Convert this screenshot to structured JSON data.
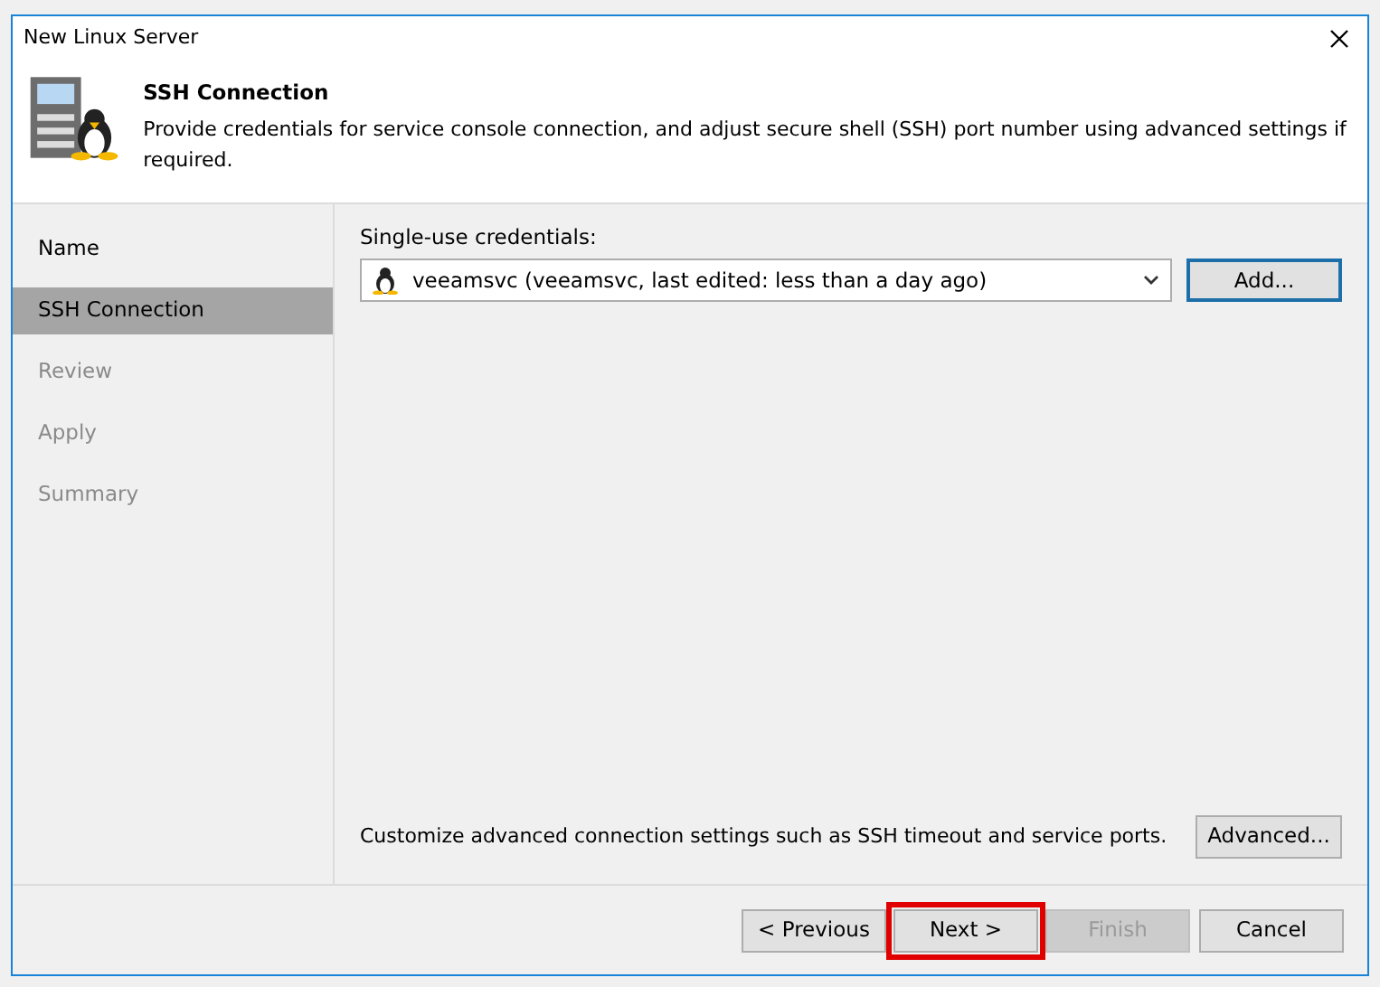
{
  "window": {
    "title": "New Linux Server"
  },
  "header": {
    "title": "SSH Connection",
    "description": "Provide credentials for service console connection, and adjust secure shell (SSH) port number using advanced settings if required."
  },
  "steps": [
    {
      "label": "Name",
      "selected": false,
      "disabled": false
    },
    {
      "label": "SSH Connection",
      "selected": true,
      "disabled": false
    },
    {
      "label": "Review",
      "selected": false,
      "disabled": true
    },
    {
      "label": "Apply",
      "selected": false,
      "disabled": true
    },
    {
      "label": "Summary",
      "selected": false,
      "disabled": true
    }
  ],
  "credentials": {
    "label": "Single-use credentials:",
    "value": "veeamsvc (veeamsvc, last edited: less than a day ago)",
    "add_button": "Add..."
  },
  "advanced": {
    "text": "Customize advanced connection settings such as SSH timeout and service ports.",
    "button": "Advanced..."
  },
  "buttons": [
    {
      "label": "< Previous",
      "disabled": false,
      "highlighted": false
    },
    {
      "label": "Next >",
      "disabled": false,
      "highlighted": true
    },
    {
      "label": "Finish",
      "disabled": true,
      "highlighted": false
    },
    {
      "label": "Cancel",
      "disabled": false,
      "highlighted": false
    }
  ]
}
